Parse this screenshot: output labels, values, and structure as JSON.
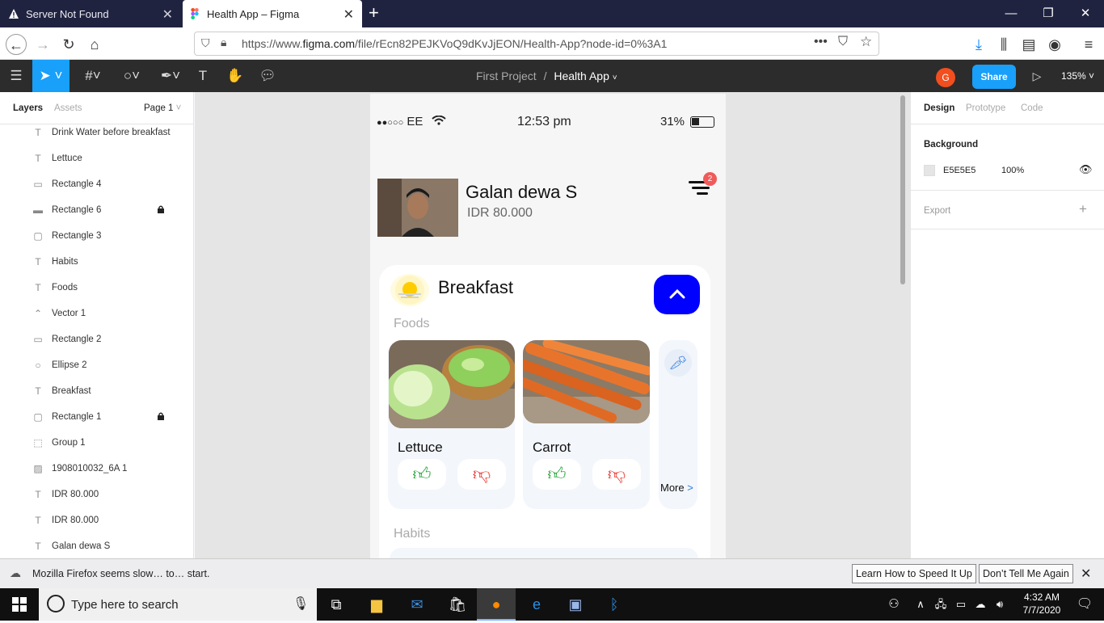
{
  "browser": {
    "tabs": [
      {
        "title": "Server Not Found"
      },
      {
        "title": "Health App – Figma"
      }
    ],
    "url_prefix": "https://www.",
    "url_domain": "figma.com",
    "url_rest": "/file/rEcn82PEJKVoQ9dKvJjEON/Health-App?node-id=0%3A1"
  },
  "figma": {
    "project": "First Project",
    "separator": "/",
    "file": "Health App",
    "avatar_letter": "G",
    "share_label": "Share",
    "zoom": "135%",
    "left_tabs": {
      "layers": "Layers",
      "assets": "Assets",
      "page": "Page 1"
    },
    "layers": [
      {
        "name": "Drink Water before breakfast",
        "icon": "T",
        "locked": false
      },
      {
        "name": "Lettuce",
        "icon": "T",
        "locked": false
      },
      {
        "name": "Rectangle 4",
        "icon": "rect-rounded",
        "locked": false
      },
      {
        "name": "Rectangle 6",
        "icon": "line",
        "locked": true
      },
      {
        "name": "Rectangle 3",
        "icon": "rect",
        "locked": false
      },
      {
        "name": "Habits",
        "icon": "T",
        "locked": false
      },
      {
        "name": "Foods",
        "icon": "T",
        "locked": false
      },
      {
        "name": "Vector 1",
        "icon": "vector",
        "locked": false
      },
      {
        "name": "Rectangle 2",
        "icon": "rect-rounded",
        "locked": false
      },
      {
        "name": "Ellipse 2",
        "icon": "ellipse",
        "locked": false
      },
      {
        "name": "Breakfast",
        "icon": "T",
        "locked": false
      },
      {
        "name": "Rectangle 1",
        "icon": "rect",
        "locked": true
      },
      {
        "name": "Group 1",
        "icon": "group",
        "locked": false
      },
      {
        "name": "1908010032_6A 1",
        "icon": "image",
        "locked": false
      },
      {
        "name": "IDR 80.000",
        "icon": "T",
        "locked": false
      },
      {
        "name": "IDR 80.000",
        "icon": "T",
        "locked": false
      },
      {
        "name": "Galan dewa S",
        "icon": "T",
        "locked": false
      }
    ],
    "right_tabs": {
      "design": "Design",
      "prototype": "Prototype",
      "code": "Code"
    },
    "background": {
      "label": "Background",
      "hex": "E5E5E5",
      "opacity": "100%"
    },
    "export_label": "Export",
    "help": "?"
  },
  "phone": {
    "carrier": "EE",
    "time": "12:53 pm",
    "battery": "31%",
    "user_name": "Galan dewa S",
    "balance": "IDR 80.000",
    "badge_count": "2",
    "section_title": "Breakfast",
    "foods_label": "Foods",
    "foods": [
      {
        "name": "Lettuce"
      },
      {
        "name": "Carrot"
      }
    ],
    "more_label": "More",
    "more_arrow": ">",
    "habits_label": "Habits"
  },
  "notification": {
    "message": "Mozilla Firefox seems slow… to… start.",
    "btn_learn": "Learn How to Speed It Up",
    "btn_dont": "Don’t Tell Me Again"
  },
  "taskbar": {
    "search_placeholder": "Type here to search",
    "time": "4:32 AM",
    "date": "7/7/2020"
  },
  "colors": {
    "accent_blue": "#18a0fb",
    "primary_blue": "#0000ff",
    "like_green": "#1ba12e",
    "dislike_red": "#e8322c",
    "badge_red": "#f15a5a"
  }
}
